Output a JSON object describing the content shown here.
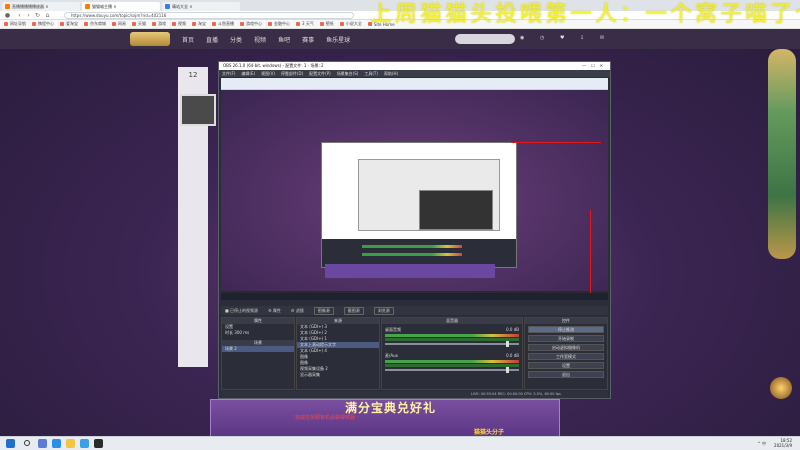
{
  "browser": {
    "tabs": [
      {
        "label": "直播播播播播放器 ×",
        "active": false
      },
      {
        "label": "猫猫喵主播 ×",
        "active": true
      },
      {
        "label": "晴站大全 ×",
        "active": false
      }
    ],
    "url": "https://www.douyu.com/topic/sxjm?rid=402116",
    "bookmarks": [
      "网址导航",
      "携程中心",
      "爱淘宝",
      "京东商城",
      "网易",
      "天猫",
      "游戏",
      "视频",
      "淘宝",
      "斗鱼直播",
      "游戏中心",
      "金融中心",
      "3 天气",
      "壁纸",
      "小说大全",
      "Site Home"
    ]
  },
  "overlay_banner": "上周猫猫头投喂第一人：一个窝子喵了个",
  "site": {
    "nav": [
      "首页",
      "直播",
      "分类",
      "视频",
      "鱼吧",
      "赛事",
      "鱼乐星球"
    ],
    "left_num": "12",
    "gift_text": "满分宝典兑好礼",
    "red_sub": "完成任务即有机会获得奖励",
    "bottom_logo": "猫猫头分子"
  },
  "obs": {
    "title": "OBS 26.1.0 (64-bit, windows) - 配置文件: 1 - 场景: 2",
    "menu": [
      "文件(F)",
      "编辑(E)",
      "视图(V)",
      "停靠部件(D)",
      "配置文件(P)",
      "场景集合(S)",
      "工具(T)",
      "帮助(H)"
    ],
    "ctrl_row": [
      "■ 已停止的视频源",
      "⚙ 属性",
      "⚙ 滤镜",
      "图像源",
      "截图源",
      "浏览源"
    ],
    "scenes_header": "场景",
    "scenes": [
      "场景 2"
    ],
    "sources_header": "来源",
    "sources": [
      "文本 (GDI+) 3",
      "文本 (GDI+) 2",
      "文本 (GDI+) 1",
      "文本上滚动提示文字",
      "文本 (GDI+) 4",
      "图像",
      "图像",
      "视频采集设备 2",
      "显示器采集"
    ],
    "source_props": [
      {
        "label": "设置",
        "value": ""
      },
      {
        "label": "时长",
        "value": "300 ms"
      }
    ],
    "mixer_header": "混音器",
    "mixer": [
      {
        "name": "桌面音频",
        "db": "0.0 dB"
      },
      {
        "name": "麦/Aux",
        "db": "0.0 dB"
      }
    ],
    "controls_header": "控件",
    "controls": [
      "停止推流",
      "开始录制",
      "启动虚拟摄像机",
      "工作室模式",
      "设置",
      "退出"
    ],
    "status": "LIVE: 00:55:04   REC: 00:00:00   CPU: 5.5%, 60.00 fps"
  },
  "taskbar": {
    "time": "18:52",
    "date": "2021/3/9",
    "tray": "^ 中"
  }
}
